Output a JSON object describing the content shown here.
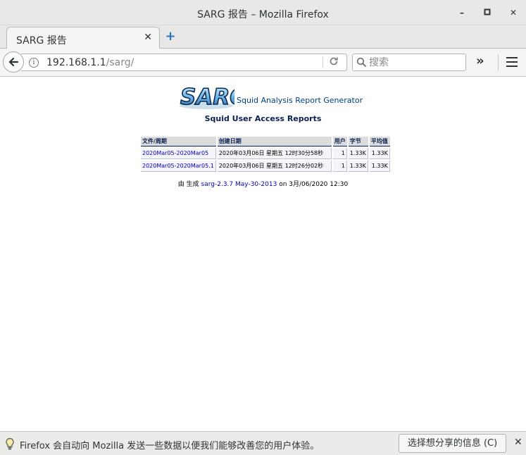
{
  "window": {
    "title": "SARG 报告  –  Mozilla Firefox",
    "controls": {
      "minimize": "–",
      "maximize": "□",
      "close": "✕"
    }
  },
  "tab": {
    "title": "SARG 报告",
    "close": "✕",
    "new_tab": "+"
  },
  "navbar": {
    "url_host": "192.168.1.1",
    "url_path": "/sarg/",
    "search_placeholder": "搜索",
    "overflow": "»"
  },
  "page": {
    "logo_text": "SARG",
    "logo_caption": "Squid Analysis Report Generator",
    "report_title": "Squid User Access Reports",
    "table": {
      "headers": [
        "文件/周期",
        "创建日期",
        "用户",
        "字节",
        "平均值"
      ],
      "rows": [
        [
          "2020Mar05-2020Mar05",
          "2020年03月06日 星期五 12时30分58秒",
          "1",
          "1.33K",
          "1.33K"
        ],
        [
          "2020Mar05-2020Mar05.1",
          "2020年03月06日 星期五 12时26分02秒",
          "1",
          "1.33K",
          "1.33K"
        ]
      ]
    },
    "generated_prefix": "由 生成",
    "generated_link": "sarg-2.3.7 May-30-2013",
    "generated_suffix": "on 3月/06/2020 12:30"
  },
  "notification": {
    "message": "Firefox 会自动向 Mozilla 发送一些数据以便我们能够改善您的用户体验。",
    "button": "选择想分享的信息 (C)",
    "close": "✕"
  },
  "colors": {
    "link": "#0000c0",
    "title_navy": "#0a1f4f",
    "newtab_blue": "#2a76c6"
  }
}
